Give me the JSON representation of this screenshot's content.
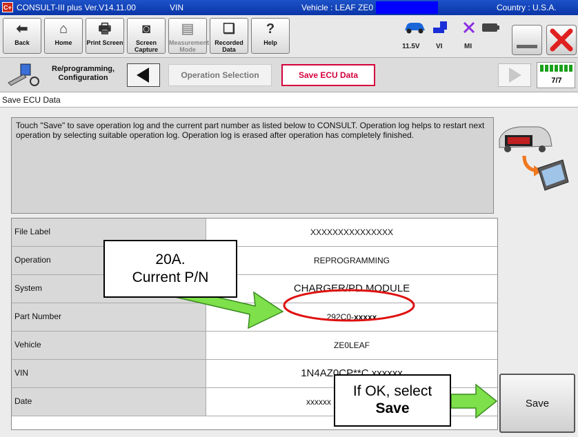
{
  "titlebar": {
    "app_name": "CONSULT-III plus  Ver.V14.11.00",
    "vin_label": "VIN",
    "vehicle": "Vehicle : LEAF ZE0",
    "country": "Country : U.S.A."
  },
  "toolbar": {
    "buttons": [
      {
        "label": "Back",
        "icon": "back-arrow-icon"
      },
      {
        "label": "Home",
        "icon": "home-icon"
      },
      {
        "label": "Print Screen",
        "icon": "printer-icon"
      },
      {
        "label": "Screen Capture",
        "icon": "camera-icon"
      },
      {
        "label": "Measurement Mode",
        "icon": "measurement-icon"
      },
      {
        "label": "Recorded Data",
        "icon": "recorded-data-icon"
      },
      {
        "label": "Help",
        "icon": "help-icon"
      }
    ],
    "battery_voltage": "11.5V",
    "vi_label": "VI",
    "mi_label": "MI"
  },
  "nav": {
    "title_line1": "Re/programming,",
    "title_line2": "Configuration",
    "tab_inactive": "Operation Selection",
    "tab_active": "Save ECU Data",
    "page_count": "7/7"
  },
  "section_title": "Save ECU Data",
  "instructions": "Touch \"Save\" to save operation log and the current part number as listed below to CONSULT. Operation log helps to restart next operation by selecting suitable operation log. Operation log is erased after operation has completely finished.",
  "table": {
    "rows": [
      {
        "label": "File Label",
        "value": "XXXXXXXXXXXXXXX"
      },
      {
        "label": "Operation",
        "value": "REPROGRAMMING"
      },
      {
        "label": "System",
        "value": "CHARGER/PD MODULE"
      },
      {
        "label": "Part Number",
        "value_prefix": "292C0-",
        "value_bold": "xxxxx"
      },
      {
        "label": "Vehicle",
        "value": "ZE0LEAF"
      },
      {
        "label": "VIN",
        "value": "1N4AZ0CP**C xxxxxx"
      },
      {
        "label": "Date",
        "value": "xxxxxx"
      }
    ]
  },
  "save_label": "Save",
  "callouts": {
    "part_line1": "20A.",
    "part_line2": "Current P/N",
    "save_line1": "If OK, select",
    "save_line2": "Save"
  },
  "colors": {
    "title_bar": "#0a35a8",
    "active_tab": "#d4003c",
    "highlight_ellipse": "#e01010",
    "arrow_green": "#7ee04a"
  }
}
